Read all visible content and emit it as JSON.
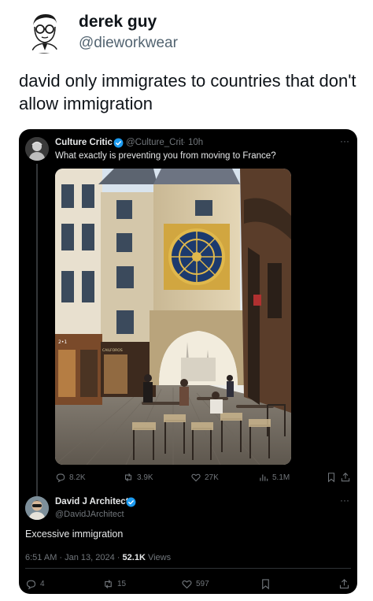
{
  "outer_post": {
    "author_name": "derek guy",
    "author_handle": "@dieworkwear",
    "text": "david only immigrates to countries that don't allow immigration"
  },
  "quoted_post": {
    "author_name": "Culture Critic",
    "author_handle": "@Culture_Crit",
    "separator": "·",
    "time": "10h",
    "more": "···",
    "text": "What exactly is preventing you from moving to France?",
    "photo_alt": "Gros Horloge astronomical clock arch over a cobbled street in Rouen",
    "sign_text": "2•1",
    "shop_sign": "CAILFOROS",
    "stats": {
      "replies": "8.2K",
      "reposts": "3.9K",
      "likes": "27K",
      "views": "5.1M"
    }
  },
  "reply_post": {
    "author_name": "David J Architect",
    "author_handle": "@DavidJArchitect",
    "more": "···",
    "text": "Excessive immigration",
    "timestamp": "6:51 AM · Jan 13, 2024 ·",
    "views_count": "52.1K",
    "views_label": "Views",
    "stats": {
      "replies": "4",
      "reposts": "15",
      "likes": "597"
    }
  },
  "colors": {
    "verified_blue": "#1d9bf0",
    "card_bg": "#000000",
    "muted": "#71767b"
  },
  "icons": [
    "reply-icon",
    "repost-icon",
    "like-icon",
    "views-icon",
    "bookmark-icon",
    "share-icon",
    "verified-icon",
    "more-icon"
  ]
}
